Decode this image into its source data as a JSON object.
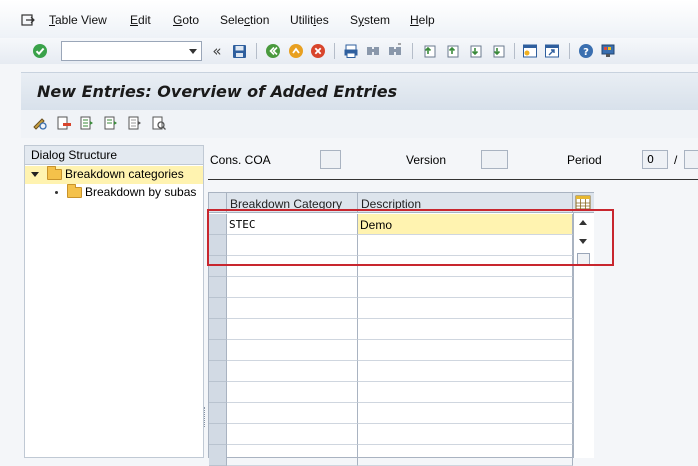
{
  "menubar": {
    "items": [
      {
        "key": "T",
        "rest": "able View"
      },
      {
        "key": "E",
        "rest": "dit"
      },
      {
        "key": "G",
        "rest": "oto"
      },
      {
        "key": "",
        "pre": "Sele",
        "ul": "c",
        "post": "tion"
      },
      {
        "key": "",
        "pre": "Utilit",
        "ul": "i",
        "post": "es"
      },
      {
        "key": "",
        "pre": "S",
        "ul": "y",
        "post": "stem"
      },
      {
        "key": "H",
        "rest": "elp"
      }
    ]
  },
  "toolbar": {
    "command_value": ""
  },
  "title": "New Entries: Overview of Added Entries",
  "dialog_structure": {
    "header": "Dialog Structure",
    "items": [
      {
        "label": "Breakdown categories",
        "selected": true
      },
      {
        "label": "Breakdown by subas",
        "selected": false
      }
    ]
  },
  "fields": {
    "cons_coa_label": "Cons. COA",
    "cons_coa_value": "",
    "version_label": "Version",
    "version_value": "",
    "period_label": "Period",
    "period_value": "0",
    "period_sep": "/"
  },
  "table": {
    "columns": [
      "Breakdown Category",
      "Description"
    ],
    "rows": [
      [
        "STEC",
        "Demo"
      ]
    ]
  },
  "colors": {
    "highlight": "#c8262e",
    "selected_tree_bg": "#fff3b0"
  }
}
